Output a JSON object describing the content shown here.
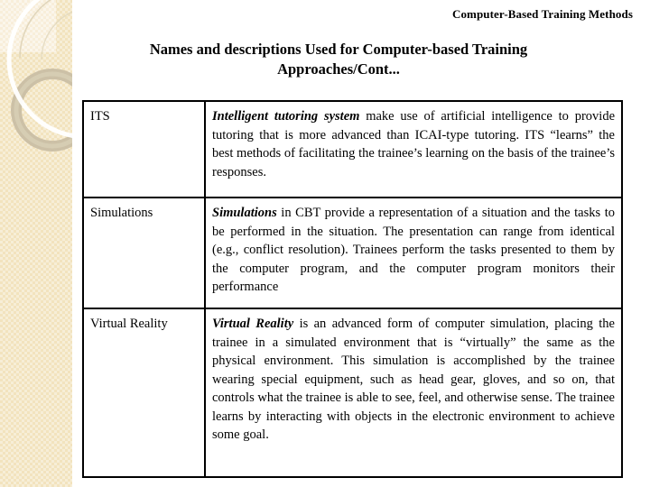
{
  "slide": {
    "header": "Computer-Based Training Methods",
    "title_line1": "Names and descriptions Used for Computer-based Training",
    "title_line2": "Approaches/Cont...",
    "colors": {
      "band": "#F2E3BE",
      "band_corner": "#F8EEDA",
      "ring": "#C9BEA4",
      "arc": "#FFFFFF",
      "text": "#000000",
      "background": "#FFFFFF",
      "table_border": "#000000"
    }
  },
  "table": {
    "rows": [
      {
        "term": "ITS",
        "lead": "Intelligent tutoring system",
        "description": " make use of artificial intelligence to provide tutoring that is more advanced than ICAI-type tutoring. ITS “learns” the best methods of facilitating the trainee’s learning on the basis of the trainee’s responses."
      },
      {
        "term": "Simulations",
        "lead": "Simulations",
        "description": " in CBT provide a representation of a situation and the tasks to be performed in the situation. The presentation can range from identical (e.g., conflict resolution). Trainees perform the tasks presented to them by the computer program, and the computer program monitors their performance"
      },
      {
        "term": "Virtual Reality",
        "lead": "Virtual Reality",
        "description": " is an advanced form of computer simulation, placing the trainee in a simulated environment that is “virtually” the same as the physical environment. This simulation is accomplished by the trainee wearing special equipment, such as head gear, gloves, and so on, that controls what the trainee is able to see, feel, and otherwise sense. The trainee learns by interacting with objects in the electronic environment to achieve some goal."
      }
    ]
  }
}
